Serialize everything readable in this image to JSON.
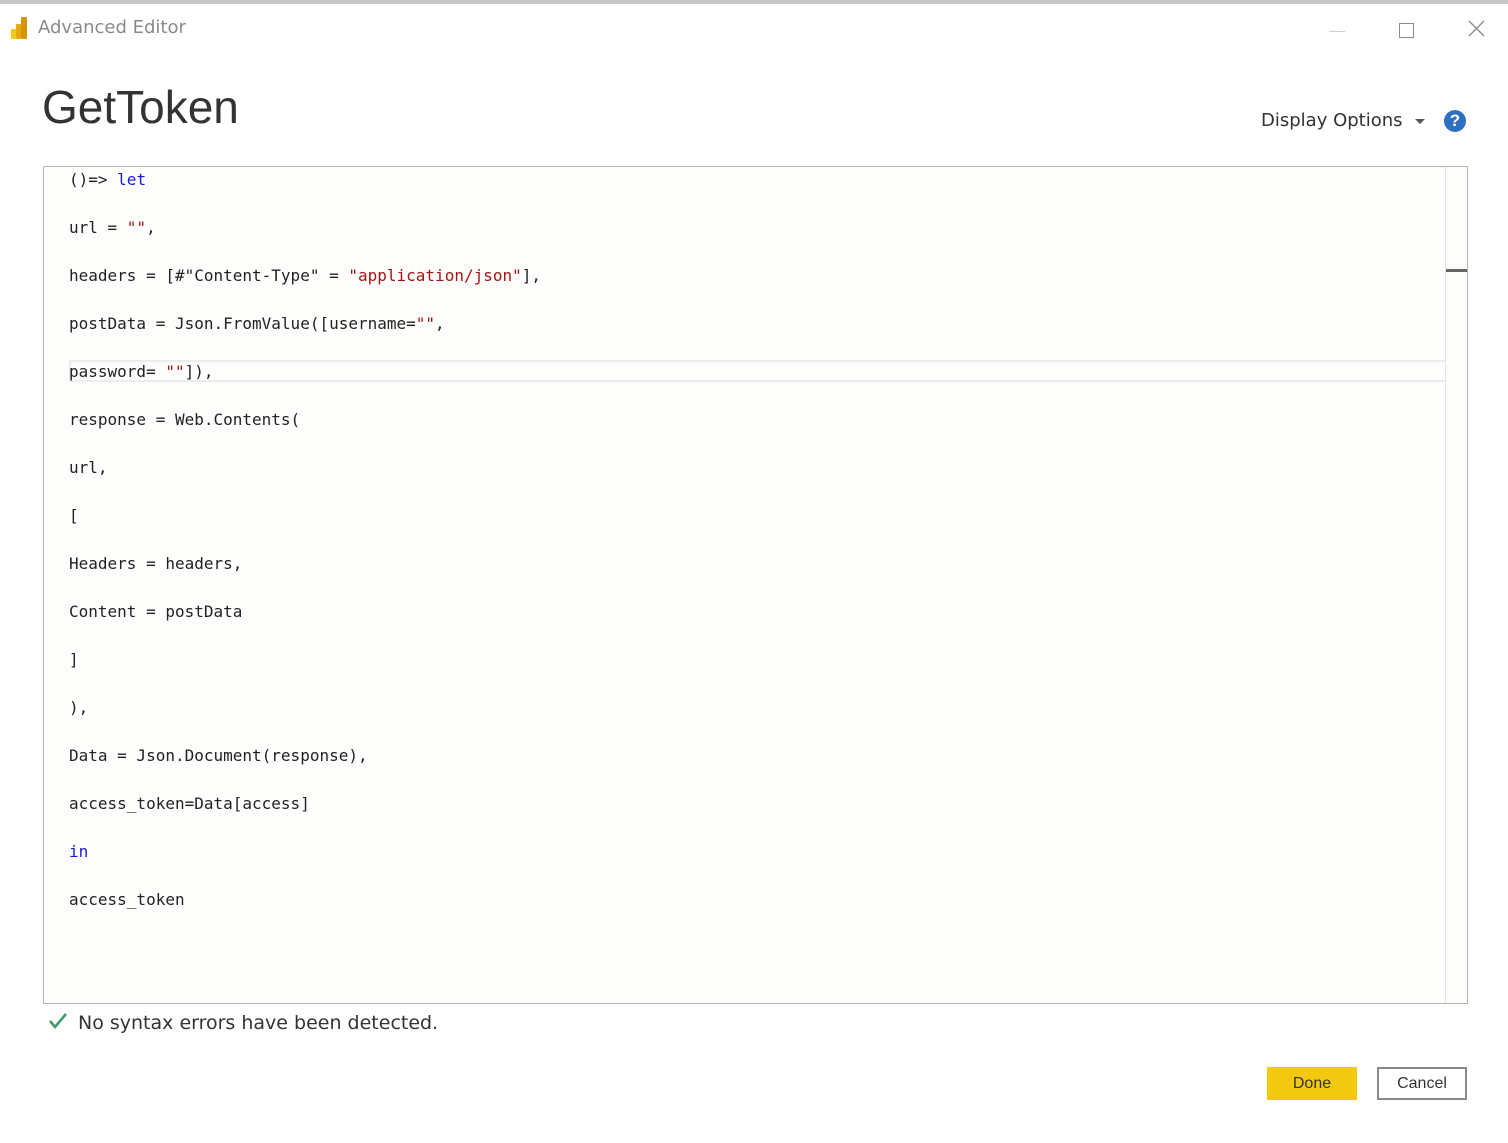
{
  "window": {
    "title": "Advanced Editor",
    "minimize_label": "",
    "maximize_label": "",
    "close_label": ""
  },
  "dialog": {
    "query_name": "GetToken",
    "display_options_label": "Display Options",
    "help_label": "?"
  },
  "editor": {
    "lines": [
      {
        "segments": [
          {
            "text": "()=> ",
            "type": "plain"
          },
          {
            "text": "let",
            "type": "keyword"
          }
        ]
      },
      {
        "segments": [
          {
            "text": "url = ",
            "type": "plain"
          },
          {
            "text": "\"\"",
            "type": "string"
          },
          {
            "text": ",",
            "type": "plain"
          }
        ]
      },
      {
        "segments": [
          {
            "text": "headers = [#\"Content-Type\" = ",
            "type": "plain"
          },
          {
            "text": "\"application/json\"",
            "type": "string"
          },
          {
            "text": "],",
            "type": "plain"
          }
        ]
      },
      {
        "segments": [
          {
            "text": "postData = Json.FromValue([username=",
            "type": "plain"
          },
          {
            "text": "\"\"",
            "type": "string"
          },
          {
            "text": ",",
            "type": "plain"
          }
        ]
      },
      {
        "segments": [
          {
            "text": "password= ",
            "type": "plain"
          },
          {
            "text": "\"\"",
            "type": "string"
          },
          {
            "text": "]),",
            "type": "plain"
          }
        ]
      },
      {
        "segments": [
          {
            "text": "response = Web.Contents(",
            "type": "plain"
          }
        ]
      },
      {
        "segments": [
          {
            "text": "url,",
            "type": "plain"
          }
        ]
      },
      {
        "segments": [
          {
            "text": "[",
            "type": "plain"
          }
        ]
      },
      {
        "segments": [
          {
            "text": "Headers = headers,",
            "type": "plain"
          }
        ]
      },
      {
        "segments": [
          {
            "text": "Content = postData",
            "type": "plain"
          }
        ]
      },
      {
        "segments": [
          {
            "text": "]",
            "type": "plain"
          }
        ]
      },
      {
        "segments": [
          {
            "text": "),",
            "type": "plain"
          }
        ]
      },
      {
        "segments": [
          {
            "text": "Data = Json.Document(response),",
            "type": "plain"
          }
        ]
      },
      {
        "segments": [
          {
            "text": "access_token=Data[access]",
            "type": "plain"
          }
        ]
      },
      {
        "segments": [
          {
            "text": "in",
            "type": "keyword"
          }
        ]
      },
      {
        "segments": [
          {
            "text": "access_token",
            "type": "plain"
          }
        ]
      }
    ]
  },
  "status": {
    "icon": "checkmark-icon",
    "message": "No syntax errors have been detected."
  },
  "buttons": {
    "done_label": "Done",
    "cancel_label": "Cancel"
  },
  "colors": {
    "keyword": "#1a1ad6",
    "string": "#a31515",
    "accent": "#f2c811",
    "status_ok": "#3d9a6c",
    "help": "#2f6fbf"
  }
}
